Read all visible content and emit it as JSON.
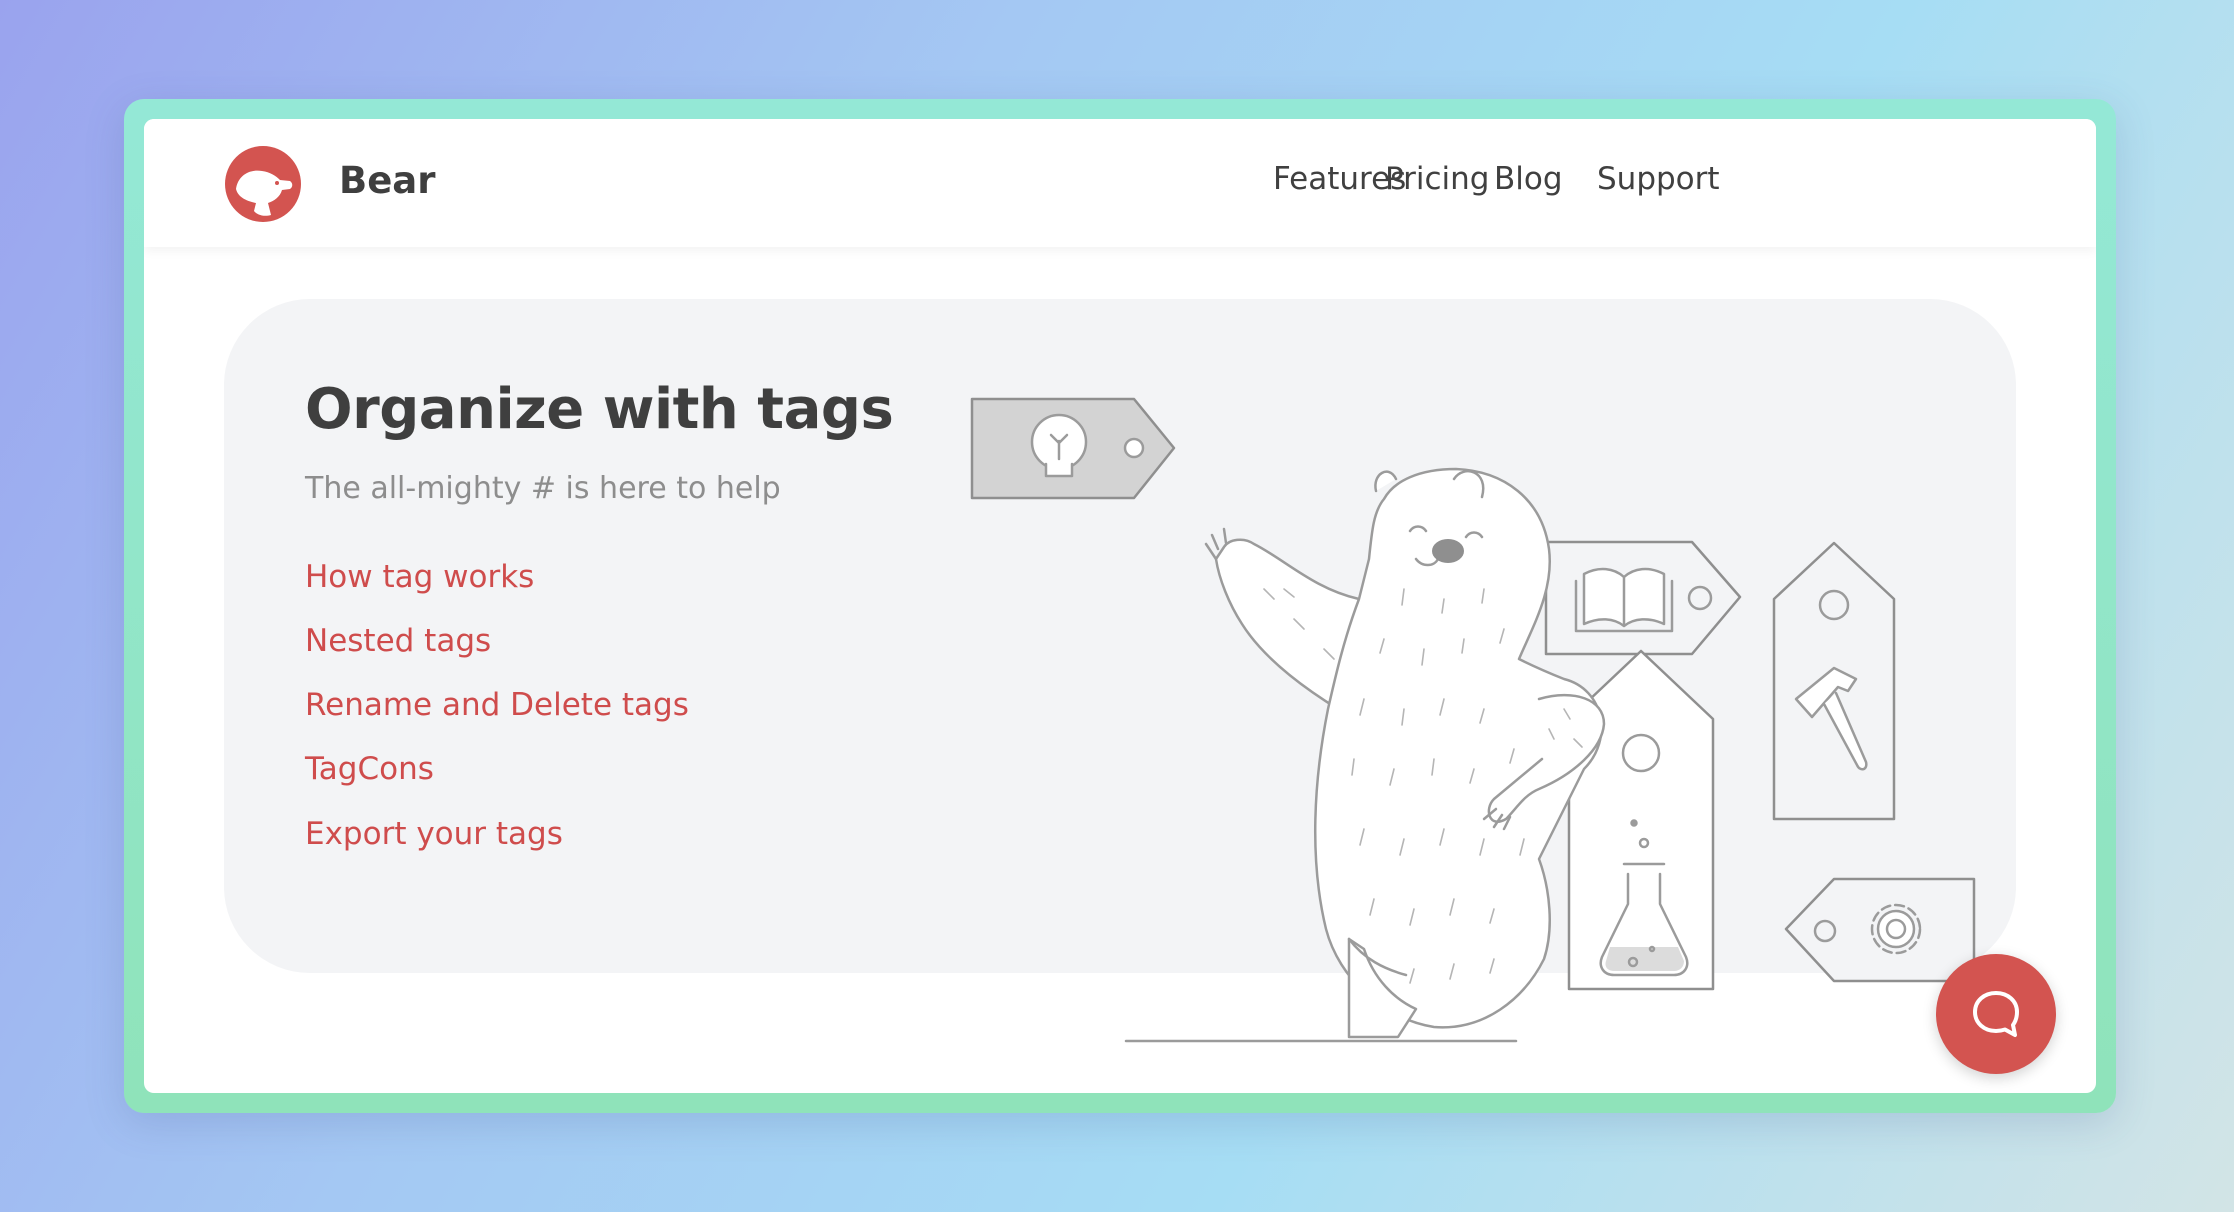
{
  "brand": {
    "name": "Bear",
    "logo_icon": "bear-logo-icon",
    "accent": "#d35450"
  },
  "nav": {
    "items": [
      {
        "label": "Features"
      },
      {
        "label": "Pricing"
      },
      {
        "label": "Blog"
      },
      {
        "label": "Support"
      }
    ]
  },
  "hero": {
    "title": "Organize with tags",
    "subtitle": "The all-mighty # is here to help",
    "links": [
      {
        "label": "How tag works"
      },
      {
        "label": "Nested tags"
      },
      {
        "label": "Rename and Delete tags"
      },
      {
        "label": "TagCons"
      },
      {
        "label": "Export your tags"
      }
    ],
    "link_color": "#cf4c4c"
  },
  "illustration": {
    "subject": "polar-bear-with-tags",
    "tag_icons": [
      "lightbulb-icon",
      "book-icon",
      "hammer-icon",
      "flask-icon",
      "gear-icon"
    ]
  },
  "chat": {
    "icon": "chat-bubble-icon"
  }
}
